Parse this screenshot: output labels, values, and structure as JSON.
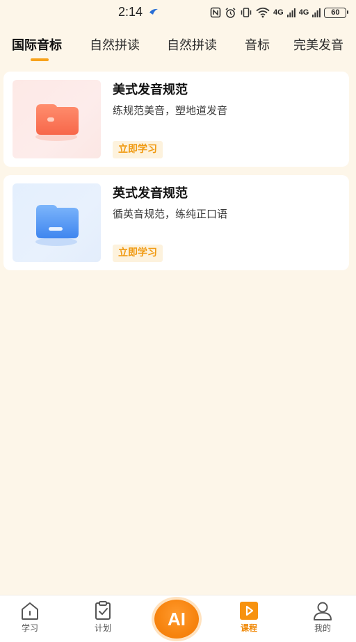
{
  "status_bar": {
    "time": "2:14",
    "network_label_1": "4G",
    "network_label_2": "4G",
    "battery": "60"
  },
  "tabs": [
    {
      "label": "国际音标",
      "active": true
    },
    {
      "label": "自然拼读",
      "active": false
    },
    {
      "label": "自然拼读",
      "active": false
    },
    {
      "label": "音标",
      "active": false
    },
    {
      "label": "完美发音",
      "active": false
    }
  ],
  "courses": [
    {
      "title": "美式发音规范",
      "description": "练规范美音，塑地道发音",
      "button": "立即学习",
      "thumb_icon": "red-folder-icon",
      "thumb_color": "#f97b5a"
    },
    {
      "title": "英式发音规范",
      "description": "循英音规范，练纯正口语",
      "button": "立即学习",
      "thumb_icon": "blue-folder-icon",
      "thumb_color": "#4f96f5"
    }
  ],
  "bottom_nav": {
    "items": [
      {
        "label": "学习",
        "icon": "home-icon",
        "active": false
      },
      {
        "label": "计划",
        "icon": "clipboard-check-icon",
        "active": false
      },
      {
        "label": "AI",
        "icon": "ai-icon",
        "active": false
      },
      {
        "label": "课程",
        "icon": "play-icon",
        "active": true
      },
      {
        "label": "我的",
        "icon": "user-icon",
        "active": false
      }
    ]
  },
  "colors": {
    "background": "#fdf6e9",
    "accent": "#f7a21b",
    "active_nav": "#f08a0a"
  }
}
